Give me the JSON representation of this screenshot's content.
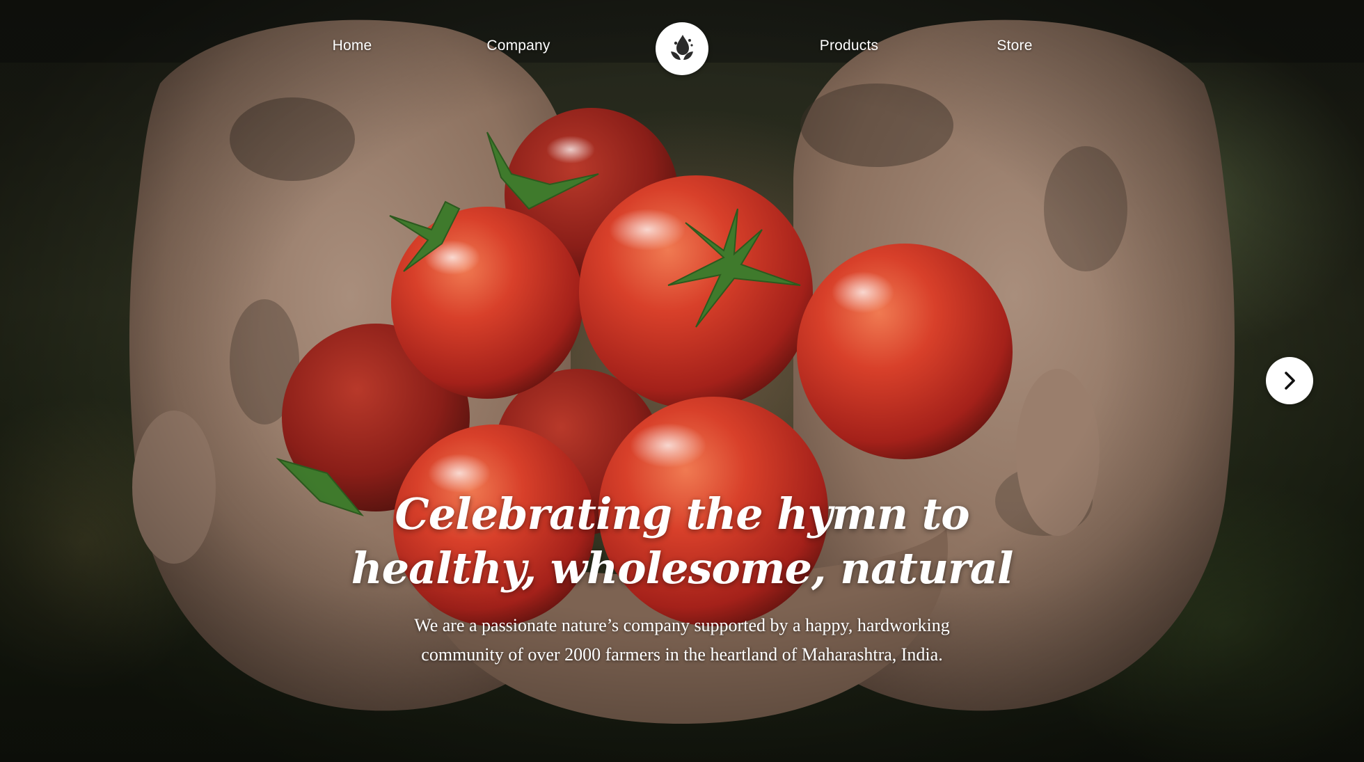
{
  "nav": {
    "items": [
      {
        "label": "Home"
      },
      {
        "label": "Company"
      },
      {
        "label": "Products"
      },
      {
        "label": "Store"
      }
    ],
    "logo_icon": "leaf-drop-logo-icon"
  },
  "hero": {
    "headline_line1": "Celebrating the hymn to",
    "headline_line2": "healthy, wholesome, natural",
    "subtext_line1": "We are a passionate nature’s company supported by a happy, hardworking",
    "subtext_line2": "community of over 2000 farmers in the heartland of Maharashtra, India.",
    "next_icon": "chevron-right-icon"
  },
  "colors": {
    "text": "#ffffff",
    "tomato": "#c8301e",
    "leaf": "#3f7a2c",
    "background": "#2e3220"
  }
}
